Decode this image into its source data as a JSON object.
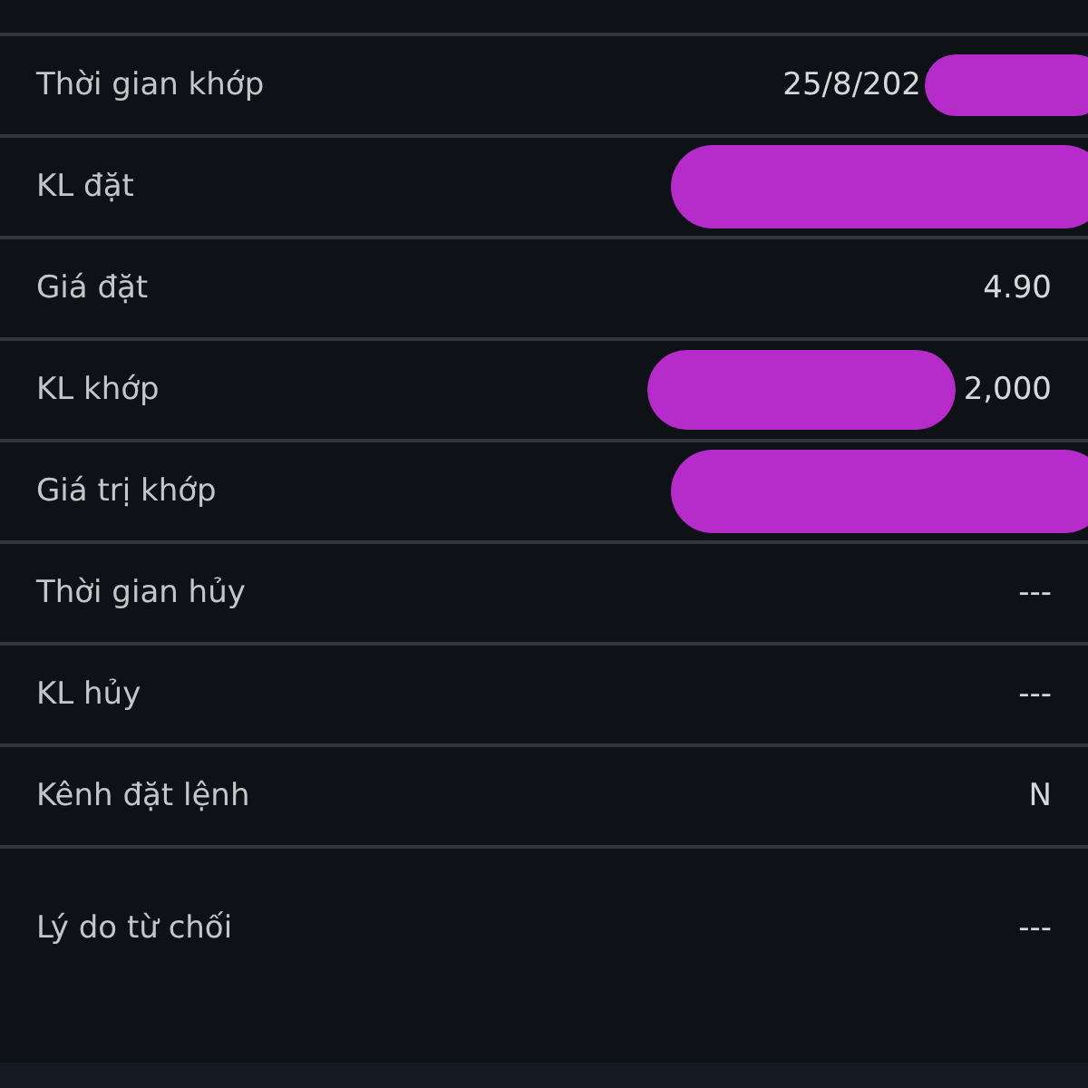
{
  "details": [
    {
      "label": "Thời gian khớp",
      "value": "25/8/202",
      "kind": "trailing"
    },
    {
      "label": "KL đặt",
      "kind": "hidden"
    },
    {
      "label": "Giá đặt",
      "value": "4.90",
      "kind": "plain"
    },
    {
      "label": "KL khớp",
      "value": "2,000",
      "kind": "leading"
    },
    {
      "label": "Giá trị khớp",
      "kind": "hidden"
    },
    {
      "label": "Thời gian hủy",
      "value": "---",
      "kind": "plain"
    },
    {
      "label": "KL hủy",
      "value": "---",
      "kind": "plain"
    },
    {
      "label": "Kênh đặt lệnh",
      "value": "N",
      "kind": "plain"
    },
    {
      "label": "Lý do từ chối",
      "value": "---",
      "kind": "tall"
    }
  ]
}
